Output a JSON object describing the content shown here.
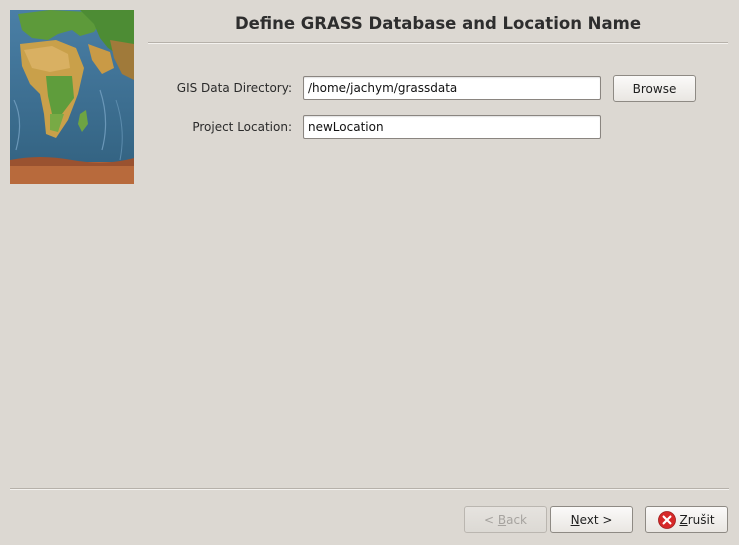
{
  "header": {
    "title": "Define GRASS Database and Location Name"
  },
  "form": {
    "gisdbase_label": "GIS Data Directory:",
    "gisdbase_value": "/home/jachym/grassdata",
    "location_label": "Project Location:",
    "location_value": "newLocation",
    "browse_label": "Browse"
  },
  "footer": {
    "back_prefix": "< ",
    "back_mnemonic": "B",
    "back_rest": "ack",
    "next_mnemonic": "N",
    "next_rest": "ext >",
    "cancel_mnemonic": "Z",
    "cancel_rest": "rušit",
    "back_enabled": false
  },
  "colors": {
    "window_bg": "#dcd8d2",
    "cancel_icon": "#d62828"
  },
  "icons": {
    "map": "world-map-image",
    "cancel": "cancel-icon"
  }
}
